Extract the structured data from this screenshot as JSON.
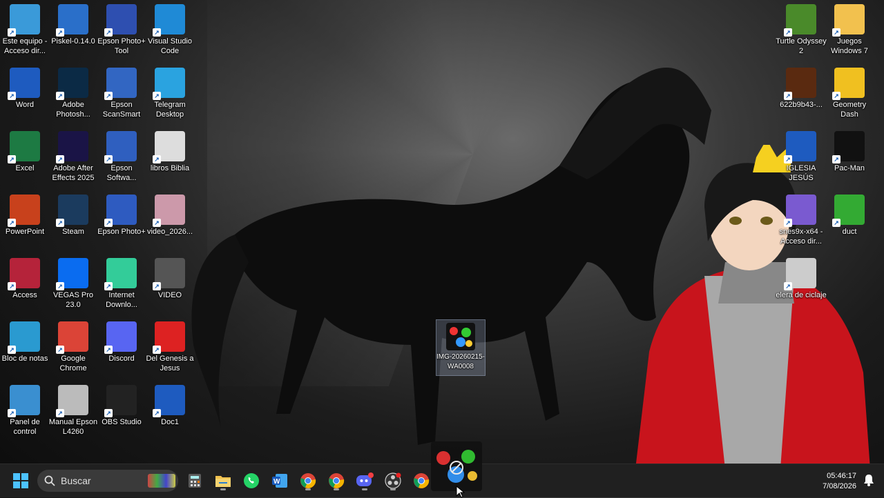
{
  "desktop": {
    "icons": [
      {
        "label": "Este equipo - Acceso dir...",
        "icon": "computer-icon",
        "color": "#3a9ad9"
      },
      {
        "label": "Piskel-0.14.0",
        "icon": "piskel-icon",
        "color": "#2a6fc9"
      },
      {
        "label": "Epson Photo+ Tool",
        "icon": "epson-photo-tool-icon",
        "color": "#2e4fb0"
      },
      {
        "label": "Visual Studio Code",
        "icon": "vscode-icon",
        "color": "#1f8ad6"
      },
      {
        "label": "Word",
        "icon": "word-icon",
        "color": "#1e5bbf"
      },
      {
        "label": "Adobe Photosh...",
        "icon": "photoshop-icon",
        "color": "#0b2a45"
      },
      {
        "label": "Epson ScanSmart",
        "icon": "scanner-icon",
        "color": "#3266c2"
      },
      {
        "label": "Telegram Desktop",
        "icon": "telegram-icon",
        "color": "#2aa3e0"
      },
      {
        "label": "Excel",
        "icon": "excel-icon",
        "color": "#1d7a43"
      },
      {
        "label": "Adobe After Effects 2025",
        "icon": "after-effects-icon",
        "color": "#1a1446"
      },
      {
        "label": "Epson Softwa...",
        "icon": "epson-software-icon",
        "color": "#2f5fbf"
      },
      {
        "label": "libros Biblia",
        "icon": "image-thumbnail-icon",
        "color": "#ddd"
      },
      {
        "label": "PowerPoint",
        "icon": "powerpoint-icon",
        "color": "#c8411c"
      },
      {
        "label": "Steam",
        "icon": "steam-icon",
        "color": "#1b3b5e"
      },
      {
        "label": "Epson Photo+",
        "icon": "epson-photo-icon",
        "color": "#2e5bc0"
      },
      {
        "label": "video_2026...",
        "icon": "video-file-icon",
        "color": "#c9a"
      },
      {
        "label": "Access",
        "icon": "access-icon",
        "color": "#b5233a"
      },
      {
        "label": "VEGAS Pro 23.0",
        "icon": "vegas-icon",
        "color": "#0a6cf0"
      },
      {
        "label": "Internet Downlo...",
        "icon": "idm-icon",
        "color": "#3c9"
      },
      {
        "label": "VIDEO",
        "icon": "video-folder-icon",
        "color": "#555"
      },
      {
        "label": "Bloc de notas",
        "icon": "notepad-icon",
        "color": "#2a9ad0"
      },
      {
        "label": "Google Chrome",
        "icon": "chrome-icon",
        "color": "#db4437"
      },
      {
        "label": "Discord",
        "icon": "discord-icon",
        "color": "#5865f2"
      },
      {
        "label": "Del Genesis a Jesus",
        "icon": "pdf-icon",
        "color": "#d22"
      },
      {
        "label": "Panel de control",
        "icon": "control-panel-icon",
        "color": "#3a8fd0"
      },
      {
        "label": "Manual Epson L4260",
        "icon": "manual-icon",
        "color": "#bbb"
      },
      {
        "label": "OBS Studio",
        "icon": "obs-icon",
        "color": "#222"
      },
      {
        "label": "Doc1",
        "icon": "word-doc-icon",
        "color": "#1e5bbf"
      }
    ],
    "right_icons": [
      {
        "label": "Turtle Odyssey 2",
        "icon": "turtle-game-icon",
        "color": "#4a8a2a"
      },
      {
        "label": "Juegos Windows 7",
        "icon": "folder-icon",
        "color": "#f2c14e"
      },
      {
        "label": "622b9b43-...",
        "icon": "game-thumbnail-icon",
        "color": "#5a2a10"
      },
      {
        "label": "Geometry Dash",
        "icon": "geometry-dash-icon",
        "color": "#f0c020"
      },
      {
        "label": "IGLESIA JESÚS",
        "icon": "word-doc-icon",
        "color": "#1e5bbf"
      },
      {
        "label": "Pac-Man",
        "icon": "pacman-icon",
        "color": "#111"
      },
      {
        "label": "snes9x-x64 - Acceso dir...",
        "icon": "snes-icon",
        "color": "#7a5ad0"
      },
      {
        "label": "duct",
        "icon": "app-icon",
        "color": "#3a3"
      },
      {
        "label": "elera de ciclaje",
        "icon": "recycle-bin-icon",
        "color": "#ccc"
      }
    ],
    "selected_file": {
      "label": "IMG-20260215-WA0008",
      "icon": "image-file-icon"
    }
  },
  "taskbar": {
    "search_placeholder": "Buscar",
    "time": "05:46:17",
    "date": "7/08/2026",
    "apps": [
      "calculator-icon",
      "file-explorer-icon",
      "whatsapp-icon",
      "word-icon",
      "chrome-icon",
      "chrome-icon",
      "discord-icon",
      "obs-icon",
      "chrome-icon"
    ],
    "colors": {
      "bg": "#202020",
      "search": "#3a3a3a",
      "accent": "#0078d4"
    }
  }
}
